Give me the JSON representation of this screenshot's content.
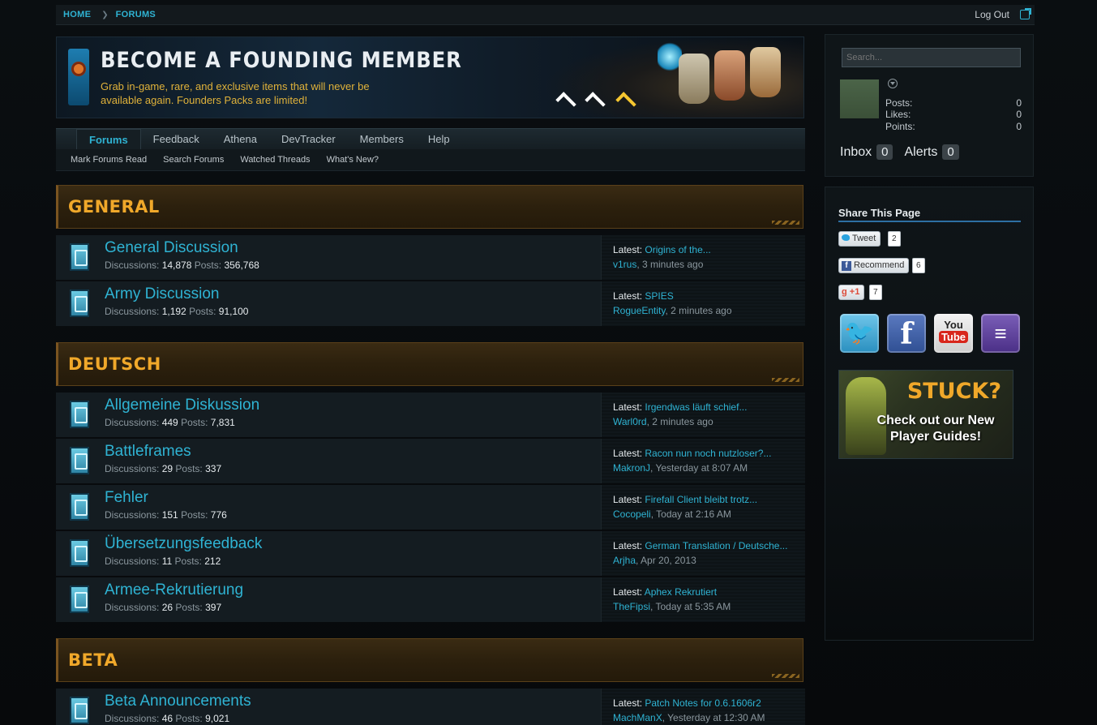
{
  "breadcrumb": {
    "home": "Home",
    "forums": "Forums"
  },
  "header": {
    "logout": "Log Out"
  },
  "banner": {
    "title": "BECOME A FOUNDING MEMBER",
    "subtitle": "Grab in-game, rare, and exclusive items that will never be available again. Founders Packs are limited!"
  },
  "nav": {
    "tabs": [
      "Forums",
      "Feedback",
      "Athena",
      "DevTracker",
      "Members",
      "Help"
    ],
    "subnav": [
      "Mark Forums Read",
      "Search Forums",
      "Watched Threads",
      "What's New?"
    ]
  },
  "categories": {
    "general": "GENERAL",
    "deutsch": "DEUTSCH",
    "beta": "BETA"
  },
  "labels": {
    "discussions": "Discussions:",
    "posts": "Posts:",
    "latest": "Latest:"
  },
  "forums": [
    {
      "title": "General Discussion",
      "discussions": "14,878",
      "posts": "356,768",
      "latest_title": "Origins of the...",
      "latest_user": "v1rus",
      "latest_time": ", 3 minutes ago"
    },
    {
      "title": "Army Discussion",
      "discussions": "1,192",
      "posts": "91,100",
      "latest_title": "SPIES",
      "latest_user": "RogueEntity",
      "latest_time": ", 2 minutes ago"
    },
    {
      "title": "Allgemeine Diskussion",
      "discussions": "449",
      "posts": "7,831",
      "latest_title": "Irgendwas läuft schief...",
      "latest_user": "Warl0rd",
      "latest_time": ", 2 minutes ago"
    },
    {
      "title": "Battleframes",
      "discussions": "29",
      "posts": "337",
      "latest_title": "Racon nun noch nutzloser?...",
      "latest_user": "MakronJ",
      "latest_time": ", Yesterday at 8:07 AM"
    },
    {
      "title": "Fehler",
      "discussions": "151",
      "posts": "776",
      "latest_title": "Firefall Client bleibt trotz...",
      "latest_user": "Cocopeli",
      "latest_time": ", Today at 2:16 AM"
    },
    {
      "title": "Übersetzungsfeedback",
      "discussions": "11",
      "posts": "212",
      "latest_title": "German Translation / Deutsche...",
      "latest_user": "Arjha",
      "latest_time": ", Apr 20, 2013"
    },
    {
      "title": "Armee-Rekrutierung",
      "discussions": "26",
      "posts": "397",
      "latest_title": "Aphex Rekrutiert",
      "latest_user": "TheFipsi",
      "latest_time": ", Today at 5:35 AM"
    },
    {
      "title": "Beta Announcements",
      "discussions": "46",
      "posts": "9,021",
      "latest_title": "Patch Notes for 0.6.1606r2",
      "latest_user": "MachManX",
      "latest_time": ", Yesterday at 12:30 AM"
    }
  ],
  "sidebar": {
    "search_placeholder": "Search...",
    "stats": [
      {
        "label": "Posts:",
        "value": "0"
      },
      {
        "label": "Likes:",
        "value": "0"
      },
      {
        "label": "Points:",
        "value": "0"
      }
    ],
    "inbox_label": "Inbox",
    "inbox_count": "0",
    "alerts_label": "Alerts",
    "alerts_count": "0",
    "share_title": "Share This Page",
    "tweet_label": "Tweet",
    "tweet_count": "2",
    "recommend_label": "Recommend",
    "recommend_count": "6",
    "gplus_label": "+1",
    "gplus_count": "7",
    "social_icons": [
      "twitter-icon",
      "facebook-icon",
      "youtube-icon",
      "twitch-icon"
    ],
    "youtube_you": "You",
    "youtube_tube": "Tube",
    "stuck_title": "STUCK?",
    "stuck_sub": "Check out our New Player Guides!"
  },
  "colors": {
    "accent": "#2fb3d3",
    "category": "#f0a82a"
  }
}
